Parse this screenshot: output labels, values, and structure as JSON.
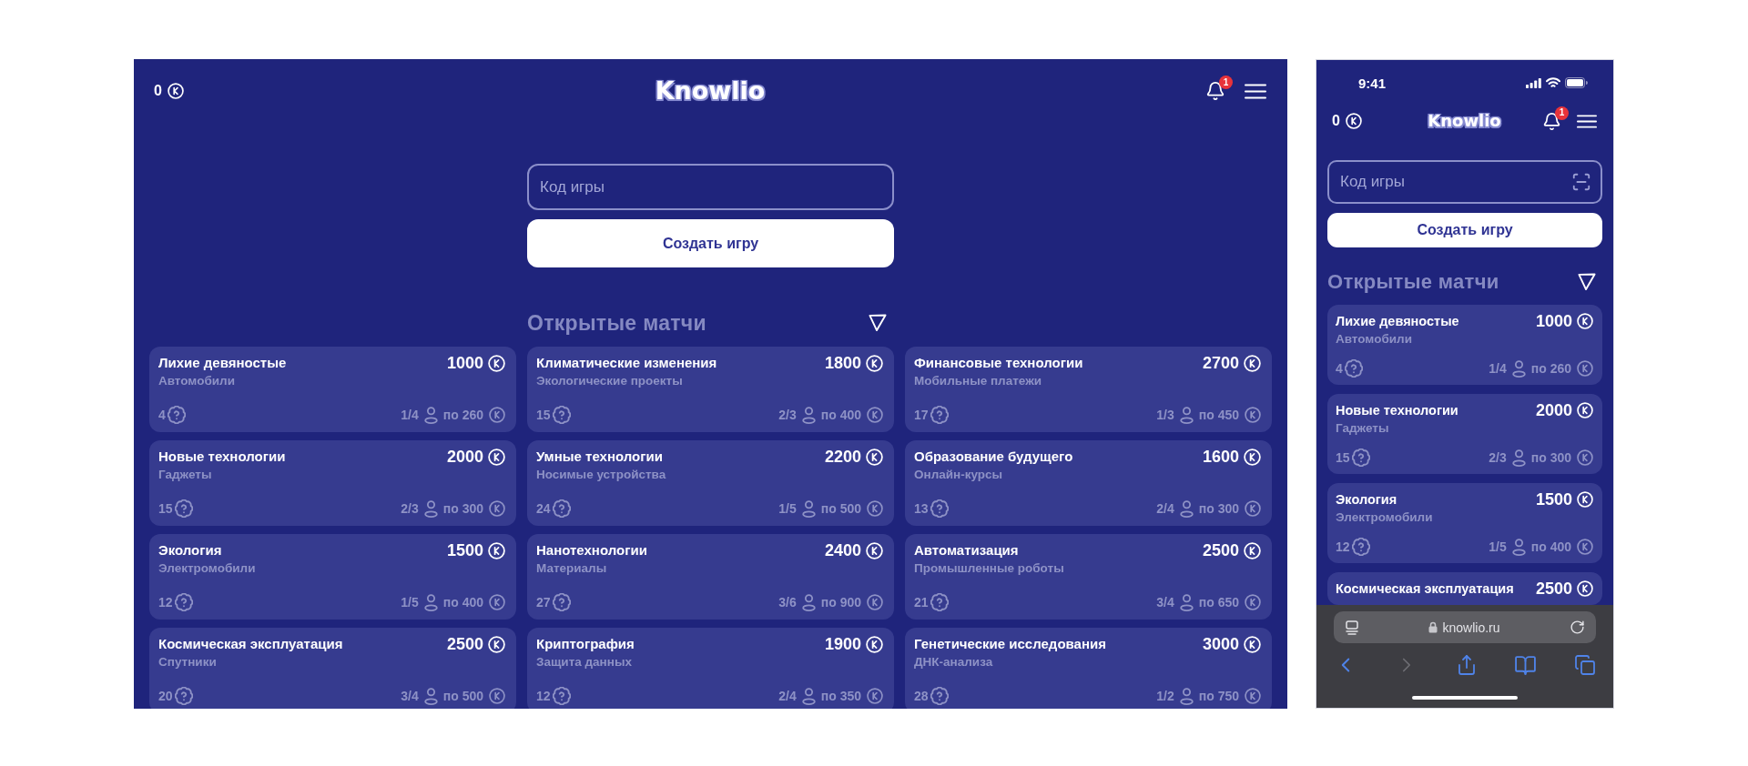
{
  "desktop": {
    "header": {
      "balance": "0",
      "logo": "Knowlio",
      "notifications": "1"
    },
    "game_code": {
      "placeholder": "Код игры"
    },
    "create_button": "Создать игру",
    "section_title": "Открытые матчи",
    "matches": [
      {
        "title": "Лихие девяностые",
        "category": "Автомобили",
        "prize": "1000",
        "questions": "4",
        "players": "1/4",
        "stake": "по 260"
      },
      {
        "title": "Климатические изменения",
        "category": "Экологические проекты",
        "prize": "1800",
        "questions": "15",
        "players": "2/3",
        "stake": "по 400"
      },
      {
        "title": "Финансовые технологии",
        "category": "Мобильные платежи",
        "prize": "2700",
        "questions": "17",
        "players": "1/3",
        "stake": "по 450"
      },
      {
        "title": "Новые технологии",
        "category": "Гаджеты",
        "prize": "2000",
        "questions": "15",
        "players": "2/3",
        "stake": "по 300"
      },
      {
        "title": "Умные технологии",
        "category": "Носимые устройства",
        "prize": "2200",
        "questions": "24",
        "players": "1/5",
        "stake": "по 500"
      },
      {
        "title": "Образование будущего",
        "category": "Онлайн-курсы",
        "prize": "1600",
        "questions": "13",
        "players": "2/4",
        "stake": "по 300"
      },
      {
        "title": "Экология",
        "category": "Электромобили",
        "prize": "1500",
        "questions": "12",
        "players": "1/5",
        "stake": "по 400"
      },
      {
        "title": "Нанотехнологии",
        "category": "Материалы",
        "prize": "2400",
        "questions": "27",
        "players": "3/6",
        "stake": "по 900"
      },
      {
        "title": "Автоматизация",
        "category": "Промышленные роботы",
        "prize": "2500",
        "questions": "21",
        "players": "3/4",
        "stake": "по 650"
      },
      {
        "title": "Космическая эксплуатация",
        "category": "Спутники",
        "prize": "2500",
        "questions": "20",
        "players": "3/4",
        "stake": "по 500"
      },
      {
        "title": "Криптография",
        "category": "Защита данных",
        "prize": "1900",
        "questions": "12",
        "players": "2/4",
        "stake": "по 350"
      },
      {
        "title": "Генетические исследования",
        "category": "ДНК-анализа",
        "prize": "3000",
        "questions": "28",
        "players": "1/2",
        "stake": "по 750"
      }
    ]
  },
  "phone": {
    "status_bar": {
      "time": "9:41"
    },
    "header": {
      "balance": "0",
      "logo": "Knowlio",
      "notifications": "1"
    },
    "game_code": {
      "placeholder": "Код игры"
    },
    "create_button": "Создать игру",
    "section_title": "Открытые матчи",
    "matches": [
      {
        "title": "Лихие девяностые",
        "category": "Автомобили",
        "prize": "1000",
        "questions": "4",
        "players": "1/4",
        "stake": "по 260"
      },
      {
        "title": "Новые технологии",
        "category": "Гаджеты",
        "prize": "2000",
        "questions": "15",
        "players": "2/3",
        "stake": "по 300"
      },
      {
        "title": "Экология",
        "category": "Электромобили",
        "prize": "1500",
        "questions": "12",
        "players": "1/5",
        "stake": "по 400"
      },
      {
        "title": "Космическая эксплуатация",
        "prize": "2500"
      }
    ],
    "browser": {
      "url": "knowlio.ru",
      "nav": [
        {
          "kind": "back",
          "disabled": false
        },
        {
          "kind": "forward",
          "disabled": true
        },
        {
          "kind": "share",
          "disabled": false
        },
        {
          "kind": "bookmarks",
          "disabled": false
        },
        {
          "kind": "tabs",
          "disabled": false
        }
      ]
    }
  }
}
